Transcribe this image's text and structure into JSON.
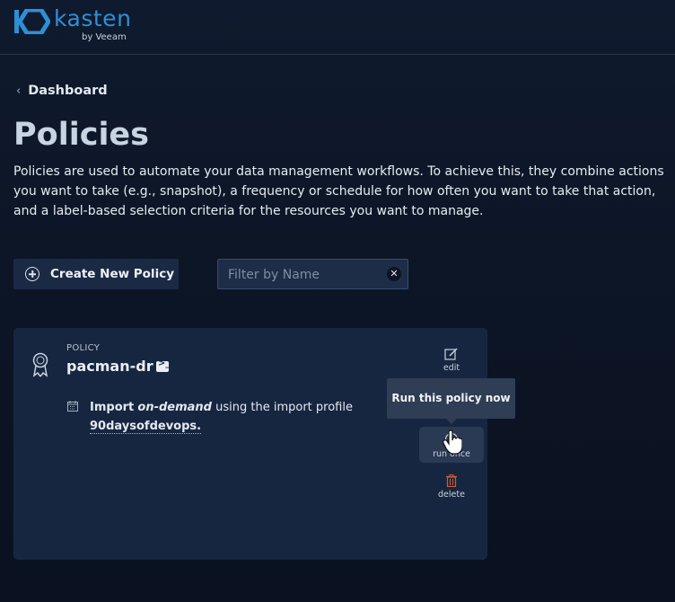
{
  "brand": {
    "name": "kasten",
    "sub": "by Veeam",
    "color": "#2f8fd6"
  },
  "nav": {
    "back_label": "Dashboard"
  },
  "page": {
    "title": "Policies",
    "description": "Policies are used to automate your data management workflows. To achieve this, they combine actions you want to take (e.g., snapshot), a frequency or schedule for how often you want to take that action, and a label-based selection criteria for the resources you want to manage."
  },
  "toolbar": {
    "create_label": "Create New Policy",
    "filter_placeholder": "Filter by Name",
    "filter_value": ""
  },
  "policy": {
    "kind": "POLICY",
    "name": "pacman-dr",
    "action_verb": "Import",
    "action_mode": "on-demand",
    "action_middle": "using the import profile",
    "profile": "90daysofdevops.",
    "actions": {
      "edit": "edit",
      "run": "run once",
      "delete": "delete"
    }
  },
  "tooltip": {
    "text": "Run this policy now"
  },
  "colors": {
    "background": "#0d1627",
    "card": "#172640",
    "delete_icon": "#d9592b"
  }
}
